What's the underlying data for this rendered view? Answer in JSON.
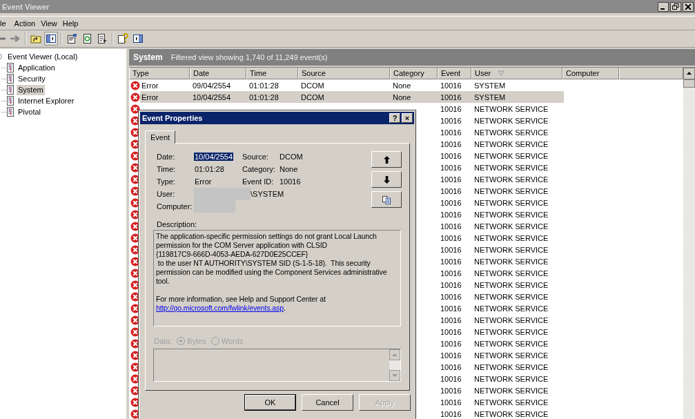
{
  "window": {
    "title": "Event Viewer"
  },
  "menu": [
    {
      "label": "le"
    },
    {
      "label": "Action"
    },
    {
      "label": "View"
    },
    {
      "label": "Help"
    }
  ],
  "tree": {
    "root": "Event Viewer (Local)",
    "children": [
      {
        "label": "Application",
        "selected": false
      },
      {
        "label": "Security",
        "selected": false
      },
      {
        "label": "System",
        "selected": true
      },
      {
        "label": "Internet Explorer",
        "selected": false
      },
      {
        "label": "Pivotal",
        "selected": false
      }
    ]
  },
  "panel": {
    "title": "System",
    "subtitle": "Filtered view showing 1,740 of 11,249 event(s)"
  },
  "table": {
    "columns": [
      {
        "label": "Type",
        "sorted": false
      },
      {
        "label": "Date",
        "sorted": false
      },
      {
        "label": "Time",
        "sorted": false
      },
      {
        "label": "Source",
        "sorted": false
      },
      {
        "label": "Category",
        "sorted": false
      },
      {
        "label": "Event",
        "sorted": false
      },
      {
        "label": "User",
        "sorted": true
      },
      {
        "label": "Computer",
        "sorted": false
      }
    ],
    "rows": [
      {
        "kind": "error",
        "type": "Error",
        "date": "09/04/2554",
        "time": "01:01:28",
        "source": "DCOM",
        "category": "None",
        "event": "10016",
        "user": "SYSTEM",
        "selected": false
      },
      {
        "kind": "error",
        "type": "Error",
        "date": "10/04/2554",
        "time": "01:01:28",
        "source": "DCOM",
        "category": "None",
        "event": "10016",
        "user": "SYSTEM",
        "selected": true
      },
      {
        "kind": "error",
        "event": "10016",
        "user": "NETWORK SERVICE",
        "selected": false
      },
      {
        "kind": "error",
        "event": "10016",
        "user": "NETWORK SERVICE",
        "selected": false
      },
      {
        "kind": "error",
        "event": "10016",
        "user": "NETWORK SERVICE",
        "selected": false
      },
      {
        "kind": "error",
        "event": "10016",
        "user": "NETWORK SERVICE",
        "selected": false
      },
      {
        "kind": "error",
        "event": "10016",
        "user": "NETWORK SERVICE",
        "selected": false
      },
      {
        "kind": "error",
        "event": "10016",
        "user": "NETWORK SERVICE",
        "selected": false
      },
      {
        "kind": "error",
        "event": "10016",
        "user": "NETWORK SERVICE",
        "selected": false
      },
      {
        "kind": "error",
        "event": "10016",
        "user": "NETWORK SERVICE",
        "selected": false
      },
      {
        "kind": "error",
        "event": "10016",
        "user": "NETWORK SERVICE",
        "selected": false
      },
      {
        "kind": "error",
        "event": "10016",
        "user": "NETWORK SERVICE",
        "selected": false
      },
      {
        "kind": "error",
        "event": "10016",
        "user": "NETWORK SERVICE",
        "selected": false
      },
      {
        "kind": "error",
        "event": "10016",
        "user": "NETWORK SERVICE",
        "selected": false
      },
      {
        "kind": "error",
        "event": "10016",
        "user": "NETWORK SERVICE",
        "selected": false
      },
      {
        "kind": "error",
        "event": "10016",
        "user": "NETWORK SERVICE",
        "selected": false
      },
      {
        "kind": "error",
        "event": "10016",
        "user": "NETWORK SERVICE",
        "selected": false
      },
      {
        "kind": "error",
        "event": "10016",
        "user": "NETWORK SERVICE",
        "selected": false
      },
      {
        "kind": "error",
        "event": "10016",
        "user": "NETWORK SERVICE",
        "selected": false
      },
      {
        "kind": "error",
        "event": "10016",
        "user": "NETWORK SERVICE",
        "selected": false
      },
      {
        "kind": "error",
        "event": "10016",
        "user": "NETWORK SERVICE",
        "selected": false
      },
      {
        "kind": "error",
        "event": "10016",
        "user": "NETWORK SERVICE",
        "selected": false
      },
      {
        "kind": "error",
        "event": "10016",
        "user": "NETWORK SERVICE",
        "selected": false
      },
      {
        "kind": "error",
        "event": "10016",
        "user": "NETWORK SERVICE",
        "selected": false
      },
      {
        "kind": "error",
        "event": "10016",
        "user": "NETWORK SERVICE",
        "selected": false
      },
      {
        "kind": "error",
        "event": "10016",
        "user": "NETWORK SERVICE",
        "selected": false
      },
      {
        "kind": "error",
        "event": "10016",
        "user": "NETWORK SERVICE",
        "selected": false
      },
      {
        "kind": "error",
        "event": "10016",
        "user": "NETWORK SERVICE",
        "selected": false
      },
      {
        "kind": "error",
        "event": "10016",
        "user": "NETWORK SERVICE",
        "selected": false
      }
    ]
  },
  "dialog": {
    "title": "Event Properties",
    "title_buttons": [
      "?",
      "×"
    ],
    "tabs": [
      {
        "label": "Event",
        "selected": true
      }
    ],
    "left_fields": [
      {
        "label": "Date:",
        "value": "10/04/2554",
        "highlighted": true,
        "redacted": false
      },
      {
        "label": "Time:",
        "value": "01:01:28",
        "highlighted": false,
        "redacted": false
      },
      {
        "label": "Type:",
        "value": "Error",
        "highlighted": false,
        "redacted": false
      },
      {
        "label": "User:",
        "value": "\\SYSTEM",
        "highlighted": false,
        "redacted": true
      },
      {
        "label": "Computer:",
        "highlighted": false,
        "redacted": true
      }
    ],
    "right_fields": [
      {
        "label": "Source:",
        "value": "DCOM"
      },
      {
        "label": "Category:",
        "value": "None"
      },
      {
        "label": "Event ID:",
        "value": "10016"
      }
    ],
    "description_label": "Description:",
    "description": "The application-specific permission settings do not grant Local Launch\npermission for the COM Server application with CLSID\n{119817C9-666D-4053-AEDA-627D0E25CCEF}\n to the user NT AUTHORITY\\SYSTEM SID (S-1-5-18).  This security\npermission can be modified using the Component Services administrative\ntool.",
    "more_info": "For more information, see Help and Support Center at",
    "link": "http://go.microsoft.com/fwlink/events.asp",
    "link_suffix": ".",
    "data_label": "Data:",
    "data_enabled": false,
    "radios": [
      {
        "label": "Bytes",
        "checked": true,
        "disabled": true
      },
      {
        "label": "Words",
        "checked": false,
        "disabled": true
      }
    ],
    "buttons": [
      {
        "label": "OK",
        "default": true,
        "disabled": false
      },
      {
        "label": "Cancel",
        "default": false,
        "disabled": false
      },
      {
        "label": "Apply",
        "default": false,
        "disabled": true
      }
    ]
  }
}
